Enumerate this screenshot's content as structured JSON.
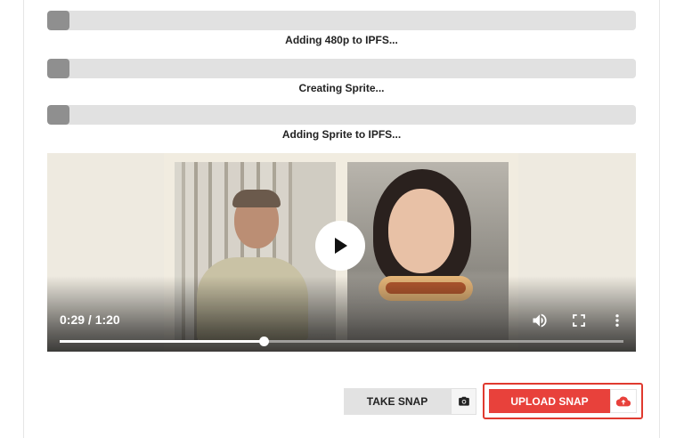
{
  "progress_steps": [
    {
      "label": "Adding 480p to IPFS...",
      "progress": 0.038
    },
    {
      "label": "Creating Sprite...",
      "progress": 0.038
    },
    {
      "label": "Adding Sprite to IPFS...",
      "progress": 0.038
    }
  ],
  "player": {
    "time_display": "0:29 / 1:20",
    "played_fraction": 0.3625,
    "icons": {
      "play": "play-icon",
      "volume": "volume-icon",
      "fullscreen": "fullscreen-icon",
      "more": "more-vert-icon"
    }
  },
  "actions": {
    "take_snap_label": "TAKE SNAP",
    "camera_icon": "camera-icon",
    "upload_snap_label": "UPLOAD SNAP",
    "upload_icon": "cloud-upload-icon"
  },
  "colors": {
    "accent_red": "#e8413b",
    "progress_fill": "#8f8f8f",
    "progress_track": "#e1e1e1"
  }
}
